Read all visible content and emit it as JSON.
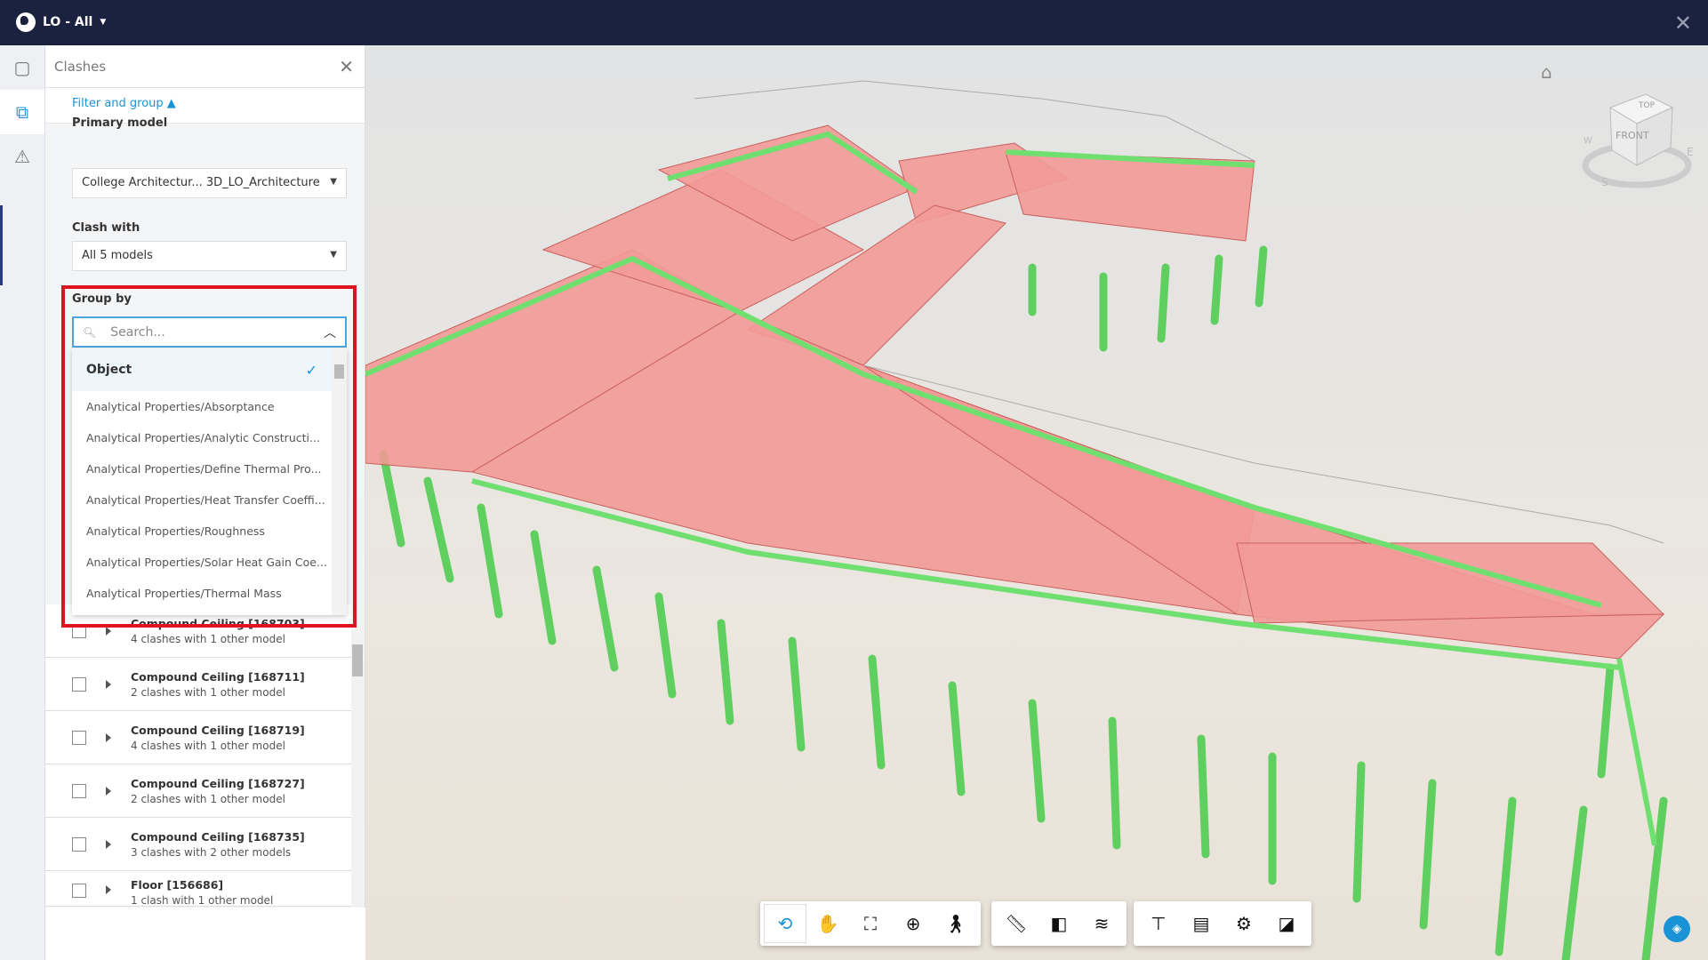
{
  "topbar": {
    "project": "LO - All",
    "close_icon": "close-icon"
  },
  "rail": {
    "items": [
      "model-browser-icon",
      "clashes-icon",
      "issues-icon"
    ]
  },
  "panel": {
    "title": "Clashes",
    "filter_group": "Filter and group ▲",
    "primary_model": {
      "label": "Primary model",
      "value": "College Architectur... 3D_LO_Architecture"
    },
    "clash_with": {
      "label": "Clash with",
      "value": "All 5 models"
    },
    "group_by": {
      "label": "Group by",
      "search_placeholder": "Search...",
      "options": [
        "Object",
        "Analytical Properties/Absorptance",
        "Analytical Properties/Analytic Constructi...",
        "Analytical Properties/Define Thermal Pro...",
        "Analytical Properties/Heat Transfer Coeffi...",
        "Analytical Properties/Roughness",
        "Analytical Properties/Solar Heat Gain Coe...",
        "Analytical Properties/Thermal Mass"
      ],
      "selected": "Object"
    },
    "rows": [
      {
        "name": "Compound Ceiling [168703]",
        "sub": "4 clashes with 1 other model"
      },
      {
        "name": "Compound Ceiling [168711]",
        "sub": "2 clashes with 1 other model"
      },
      {
        "name": "Compound Ceiling [168719]",
        "sub": "4 clashes with 1 other model"
      },
      {
        "name": "Compound Ceiling [168727]",
        "sub": "2 clashes with 1 other model"
      },
      {
        "name": "Compound Ceiling [168735]",
        "sub": "3 clashes with 2 other models"
      },
      {
        "name": "Floor [156686]",
        "sub": "1 clash with 1 other model"
      }
    ]
  },
  "viewcube": {
    "top": "TOP",
    "front": "FRONT",
    "n": "N",
    "e": "E",
    "s": "S",
    "w": "W"
  },
  "colors": {
    "clash_primary": "#f08b88",
    "clash_other": "#7fe37f",
    "accent": "#1a93d6",
    "highlight": "#e0141e"
  },
  "toolbar": {
    "groups": [
      [
        "orbit",
        "pan",
        "fit-to-view",
        "zoom-window",
        "first-person"
      ],
      [
        "measure",
        "section",
        "explode-layers"
      ],
      [
        "model-tree",
        "properties",
        "settings",
        "fullscreen"
      ]
    ]
  }
}
